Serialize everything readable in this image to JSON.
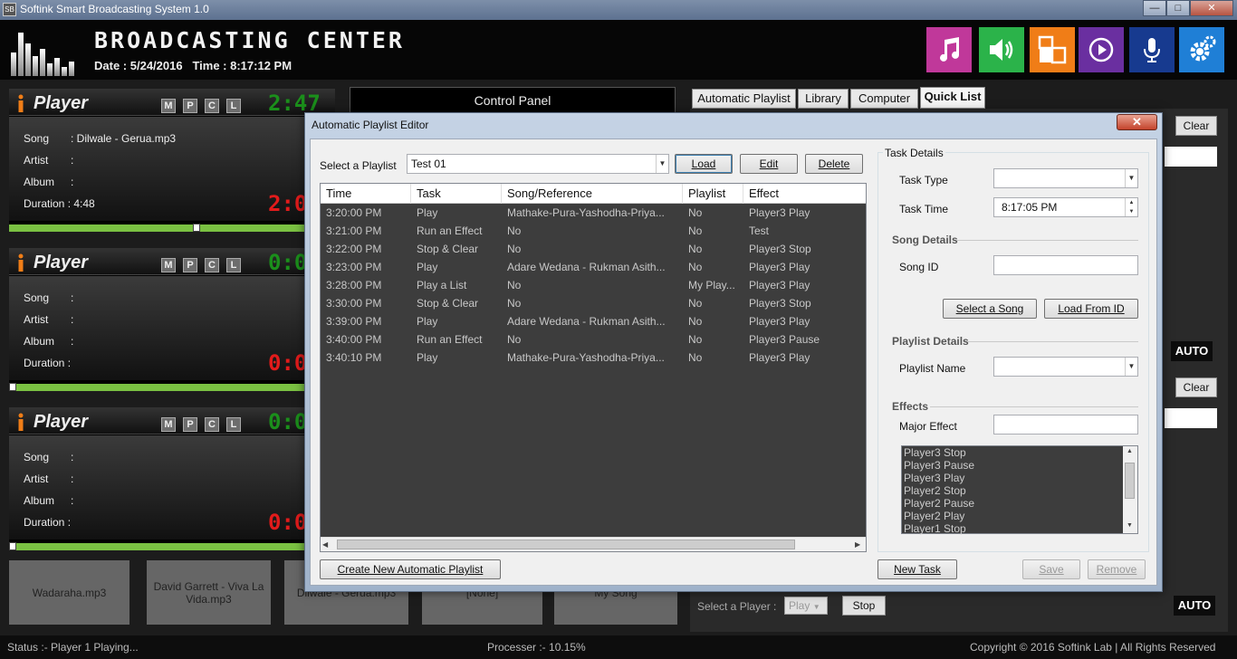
{
  "window": {
    "title": "Softink Smart Broadcasting System 1.0",
    "app_icon": "SB",
    "minimize": "—",
    "maximize": "□",
    "close": "✕"
  },
  "header": {
    "title": "BROADCASTING CENTER",
    "date_label": "Date :",
    "date": "5/24/2016",
    "time_label": "Time :",
    "time": "8:17:12 PM",
    "tiles": [
      {
        "icon": "music-note-icon",
        "color": "#c0389a"
      },
      {
        "icon": "speaker-icon",
        "color": "#2bb34a"
      },
      {
        "icon": "blocks-icon",
        "color": "#f07d17"
      },
      {
        "icon": "play-circle-icon",
        "color": "#6a2fa0"
      },
      {
        "icon": "microphone-icon",
        "color": "#173a8f"
      },
      {
        "icon": "gear-icon",
        "color": "#1f7fd6"
      }
    ]
  },
  "players": [
    {
      "title": "Player",
      "info_icon": "i",
      "buttons": [
        "M",
        "P",
        "C",
        "L"
      ],
      "elapsed": "2:47",
      "remaining": "2:0",
      "song_label": "Song",
      "song": "Dilwale - Gerua.mp3",
      "artist_label": "Artist",
      "artist": "",
      "album_label": "Album",
      "album": "",
      "duration_label": "Duration :",
      "duration": "4:48",
      "progress": 0.58
    },
    {
      "title": "Player",
      "info_icon": "i",
      "buttons": [
        "M",
        "P",
        "C",
        "L"
      ],
      "elapsed": "0:0",
      "remaining": "0:0",
      "song_label": "Song",
      "song": "",
      "artist_label": "Artist",
      "artist": "",
      "album_label": "Album",
      "album": "",
      "duration_label": "Duration :",
      "duration": "",
      "progress": 0
    },
    {
      "title": "Player",
      "info_icon": "i",
      "buttons": [
        "M",
        "P",
        "C",
        "L"
      ],
      "elapsed": "0:0",
      "remaining": "0:0",
      "song_label": "Song",
      "song": "",
      "artist_label": "Artist",
      "artist": "",
      "album_label": "Album",
      "album": "",
      "duration_label": "Duration :",
      "duration": "",
      "progress": 0
    }
  ],
  "quick_buttons": [
    "Wadaraha.mp3",
    "David Garrett - Viva La Vida.mp3",
    "Dilwale - Gerua.mp3",
    "[None]",
    "My Song"
  ],
  "control_panel": {
    "title": "Control Panel"
  },
  "right_tabs": [
    "Automatic Playlist",
    "Library",
    "Computer",
    "Quick List"
  ],
  "right_panel": {
    "clear1": "Clear",
    "clear2": "Clear",
    "auto1": "AUTO",
    "auto2": "AUTO",
    "auto3": "AUTO",
    "select_player_label": "Select a Player :",
    "select_player_value": "Play",
    "stop": "Stop"
  },
  "dialog": {
    "title": "Automatic Playlist Editor",
    "close": "✕",
    "select_playlist_label": "Select a Playlist",
    "playlist_value": "Test 01",
    "load": "Load",
    "edit": "Edit",
    "delete": "Delete",
    "columns": [
      "Time",
      "Task",
      "Song/Reference",
      "Playlist",
      "Effect"
    ],
    "rows": [
      [
        "3:20:00 PM",
        "Play",
        "Mathake-Pura-Yashodha-Priya...",
        "No",
        "Player3 Play"
      ],
      [
        "3:21:00 PM",
        "Run an Effect",
        "No",
        "No",
        "Test"
      ],
      [
        "3:22:00 PM",
        "Stop & Clear",
        "No",
        "No",
        "Player3 Stop"
      ],
      [
        "3:23:00 PM",
        "Play",
        "Adare Wedana - Rukman Asith...",
        "No",
        "Player3 Play"
      ],
      [
        "3:28:00 PM",
        "Play a List",
        "No",
        "My Play...",
        "Player3 Play"
      ],
      [
        "3:30:00 PM",
        "Stop & Clear",
        "No",
        "No",
        "Player3 Stop"
      ],
      [
        "3:39:00 PM",
        "Play",
        "Adare Wedana - Rukman Asith...",
        "No",
        "Player3 Play"
      ],
      [
        "3:40:00 PM",
        "Run an Effect",
        "No",
        "No",
        "Player3 Pause"
      ],
      [
        "3:40:10 PM",
        "Play",
        "Mathake-Pura-Yashodha-Priya...",
        "No",
        "Player3 Play"
      ]
    ],
    "create_new": "Create New Automatic Playlist",
    "task_details": {
      "group": "Task Details",
      "task_type_label": "Task Type",
      "task_type_value": "",
      "task_time_label": "Task Time",
      "task_time_value": "8:17:05 PM",
      "song_details": "Song Details",
      "song_id_label": "Song ID",
      "song_id_value": "",
      "select_song": "Select a Song",
      "load_from_id": "Load From ID",
      "playlist_details": "Playlist Details",
      "playlist_name_label": "Playlist Name",
      "playlist_name_value": "",
      "effects": "Effects",
      "major_effect_label": "Major Effect",
      "major_effect_value": "",
      "effect_list": [
        "Player3 Stop",
        "Player3 Pause",
        "Player3 Play",
        "Player2 Stop",
        "Player2 Pause",
        "Player2 Play",
        "Player1 Stop"
      ]
    },
    "new_task": "New Task",
    "save": "Save",
    "remove": "Remove"
  },
  "status": {
    "left": "Status :- Player 1 Playing...",
    "center": "Processer :- 10.15%",
    "right": "Copyright © 2016 Softink Lab | All Rights Reserved"
  }
}
